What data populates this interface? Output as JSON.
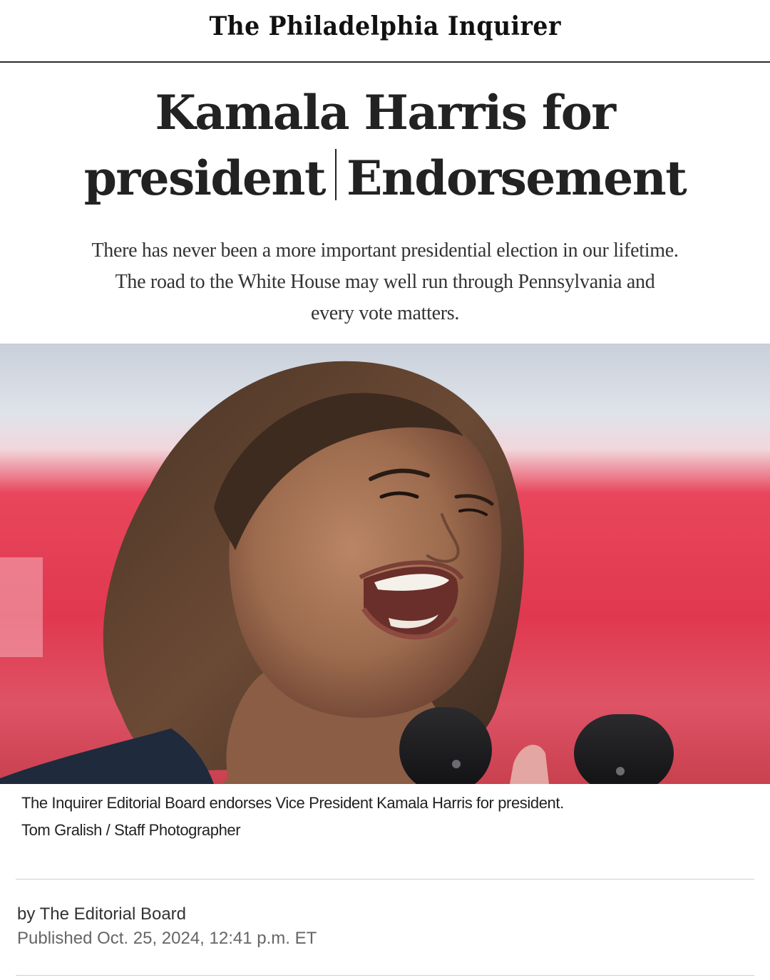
{
  "masthead": {
    "title": "The Philadelphia Inquirer"
  },
  "article": {
    "headline_line1": "Kamala Harris for",
    "headline_line2_part1": "president",
    "headline_line2_part2": "Endorsement",
    "dek_line1": "There has never been a more important presidential election in our lifetime.",
    "dek_line2": "The road to the White House may well run through Pennsylvania and",
    "dek_line3": "every vote matters.",
    "caption": "The Inquirer Editorial Board endorses Vice President Kamala Harris for president.",
    "credit": "Tom Gralish / Staff Photographer",
    "byline": "by The Editorial Board",
    "published": "Published Oct. 25, 2024, 12:41 p.m. ET"
  },
  "colors": {
    "text": "#222222",
    "rule": "#cfcfcf",
    "backdrop_red": "#e0394f",
    "backdrop_sky": "#d7dde6"
  }
}
